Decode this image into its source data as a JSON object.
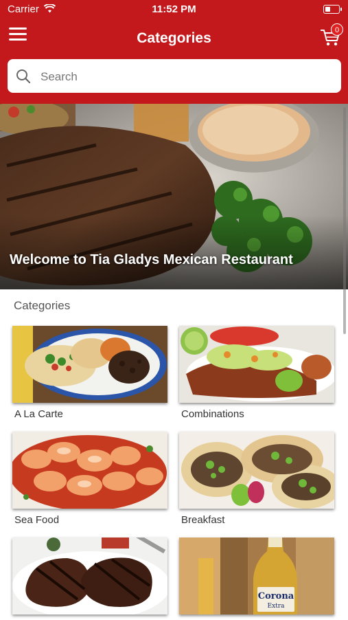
{
  "status_bar": {
    "carrier": "Carrier",
    "time": "11:52 PM"
  },
  "nav": {
    "title": "Categories",
    "cart_count": "0"
  },
  "search": {
    "placeholder": "Search"
  },
  "hero": {
    "text": "Welcome to Tia Gladys Mexican Restaurant"
  },
  "section": {
    "title": "Categories"
  },
  "categories": [
    {
      "label": "A La Carte"
    },
    {
      "label": "Combinations"
    },
    {
      "label": "Sea Food"
    },
    {
      "label": "Breakfast"
    },
    {
      "label": ""
    },
    {
      "label": ""
    }
  ],
  "beer_label": {
    "line1": "Corona",
    "line2": "Extra"
  },
  "colors": {
    "brand": "#c4191c",
    "background": "#ffffff"
  },
  "icons": [
    "wifi-icon",
    "battery-icon",
    "menu-icon",
    "cart-icon",
    "search-icon"
  ]
}
